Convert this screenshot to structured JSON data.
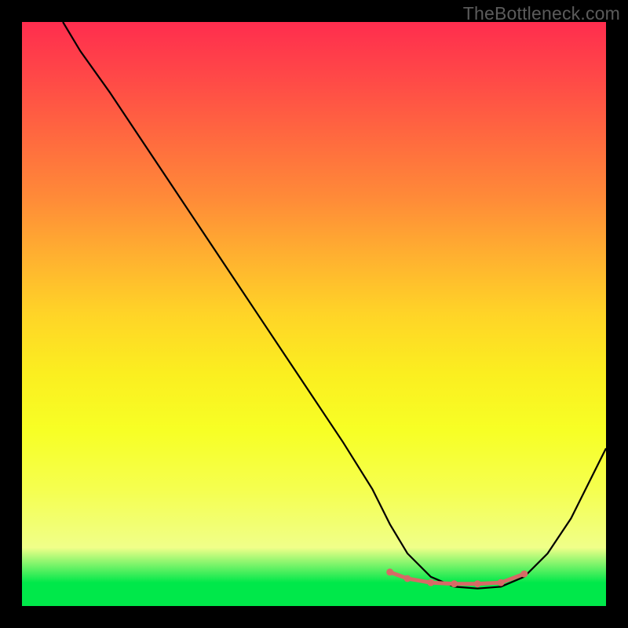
{
  "watermark": "TheBottleneck.com",
  "chart_data": {
    "type": "line",
    "title": "",
    "xlabel": "",
    "ylabel": "",
    "xlim": [
      0,
      100
    ],
    "ylim": [
      0,
      100
    ],
    "grid": false,
    "legend": false,
    "series": [
      {
        "name": "curve",
        "color": "#000000",
        "x": [
          7,
          10,
          15,
          20,
          25,
          30,
          35,
          40,
          45,
          50,
          55,
          60,
          63,
          66,
          70,
          74,
          78,
          82,
          86,
          90,
          94,
          100
        ],
        "y": [
          100,
          95,
          88,
          80.5,
          73,
          65.5,
          58,
          50.5,
          43,
          35.5,
          28,
          20,
          14,
          9,
          5,
          3.3,
          3,
          3.3,
          5,
          9,
          15,
          27
        ]
      },
      {
        "name": "highlight-dots",
        "color": "#d66a66",
        "x": [
          63,
          66,
          70,
          74,
          78,
          82,
          86
        ],
        "y": [
          5.8,
          4.7,
          4.0,
          3.8,
          3.8,
          4.0,
          5.5
        ]
      }
    ]
  }
}
